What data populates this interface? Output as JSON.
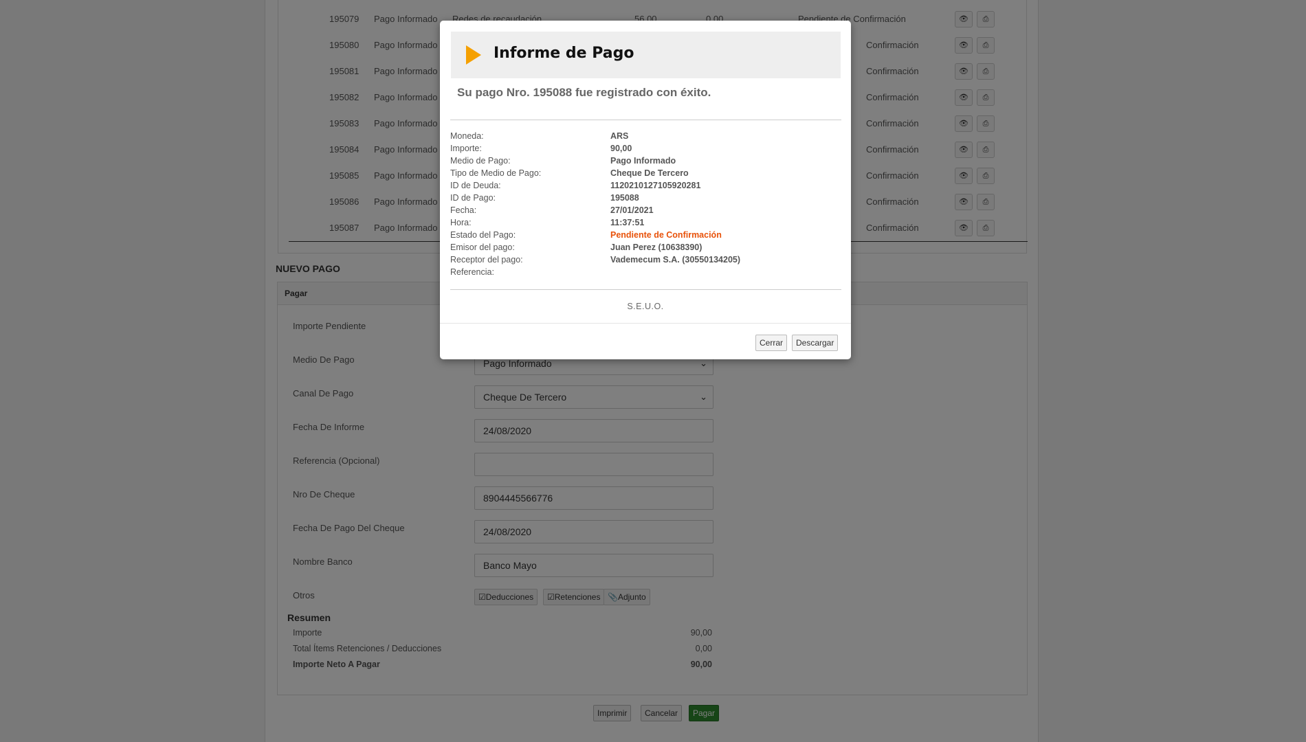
{
  "history": {
    "rows": [
      {
        "id": "195079",
        "medio": "Pago Informado",
        "canal": "Redes de recaudación",
        "importe": "56,00",
        "retenciones": "0,00",
        "estado": "Pendiente de Confirmación"
      },
      {
        "id": "195080",
        "medio": "Pago Informado",
        "canal": "",
        "importe": "",
        "retenciones": "",
        "estado": "Confirmación"
      },
      {
        "id": "195081",
        "medio": "Pago Informado",
        "canal": "",
        "importe": "",
        "retenciones": "",
        "estado": "Confirmación"
      },
      {
        "id": "195082",
        "medio": "Pago Informado",
        "canal": "",
        "importe": "",
        "retenciones": "",
        "estado": "Confirmación"
      },
      {
        "id": "195083",
        "medio": "Pago Informado",
        "canal": "",
        "importe": "",
        "retenciones": "",
        "estado": "Confirmación"
      },
      {
        "id": "195084",
        "medio": "Pago Informado",
        "canal": "",
        "importe": "",
        "retenciones": "",
        "estado": "Confirmación"
      },
      {
        "id": "195085",
        "medio": "Pago Informado",
        "canal": "",
        "importe": "",
        "retenciones": "",
        "estado": "Confirmación"
      },
      {
        "id": "195086",
        "medio": "Pago Informado",
        "canal": "",
        "importe": "",
        "retenciones": "",
        "estado": "Confirmación"
      },
      {
        "id": "195087",
        "medio": "Pago Informado",
        "canal": "",
        "importe": "",
        "retenciones": "",
        "estado": "Confirmación"
      }
    ],
    "icons": {
      "view": "eye-icon",
      "print": "printer-icon"
    }
  },
  "nuevo_pago": {
    "title": "NUEVO PAGO",
    "panel_title": "Pagar",
    "fields": {
      "importe_pendiente": {
        "label": "Importe Pendiente"
      },
      "medio_de_pago": {
        "label": "Medio De Pago",
        "value": "Pago Informado"
      },
      "canal_de_pago": {
        "label": "Canal De Pago",
        "value": "Cheque De Tercero"
      },
      "fecha_de_informe": {
        "label": "Fecha De Informe",
        "value": "24/08/2020"
      },
      "referencia": {
        "label": "Referencia (Opcional)",
        "value": ""
      },
      "nro_de_cheque": {
        "label": "Nro De Cheque",
        "value": "8904445566776"
      },
      "fecha_pago_cheque": {
        "label": "Fecha De Pago Del Cheque",
        "value": "24/08/2020"
      },
      "nombre_banco": {
        "label": "Nombre Banco",
        "value": "Banco Mayo"
      },
      "otros": {
        "label": "Otros"
      }
    },
    "otros_buttons": {
      "deducciones": "Deducciones",
      "retenciones": "Retenciones",
      "adjunto": "Adjunto"
    },
    "resumen": {
      "title": "Resumen",
      "importe": {
        "label": "Importe",
        "value": "90,00"
      },
      "total_items": {
        "label": "Total Ítems Retenciones / Deducciones",
        "value": "0,00"
      },
      "neto": {
        "label": "Importe Neto A Pagar",
        "value": "90,00"
      }
    },
    "buttons": {
      "imprimir": "Imprimir",
      "cancelar": "Cancelar",
      "pagar": "Pagar"
    }
  },
  "modal": {
    "title": "Informe de Pago",
    "message": "Su pago Nro. 195088 fue registrado con éxito.",
    "details": [
      {
        "key": "Moneda:",
        "value": "ARS"
      },
      {
        "key": "Importe:",
        "value": "90,00"
      },
      {
        "key": "Medio de Pago:",
        "value": "Pago Informado"
      },
      {
        "key": "Tipo de Medio de Pago:",
        "value": "Cheque De Tercero"
      },
      {
        "key": "ID de Deuda:",
        "value": "1120210127105920281"
      },
      {
        "key": "ID de Pago:",
        "value": "195088"
      },
      {
        "key": "Fecha:",
        "value": "27/01/2021"
      },
      {
        "key": "Hora:",
        "value": "11:37:51"
      },
      {
        "key": "Estado del Pago:",
        "value": "Pendiente de Confirmación"
      },
      {
        "key": "Emisor del pago:",
        "value": "Juan Perez (10638390)"
      },
      {
        "key": "Receptor del pago:",
        "value": "Vademecum S.A. (30550134205)"
      },
      {
        "key": "Referencia:",
        "value": ""
      }
    ],
    "footer_note": "S.E.U.O.",
    "buttons": {
      "cerrar": "Cerrar",
      "descargar": "Descargar"
    },
    "colors": {
      "accent": "#f5a000",
      "status_pending": "#e8520a",
      "header_bg": "#eeeeee"
    }
  }
}
